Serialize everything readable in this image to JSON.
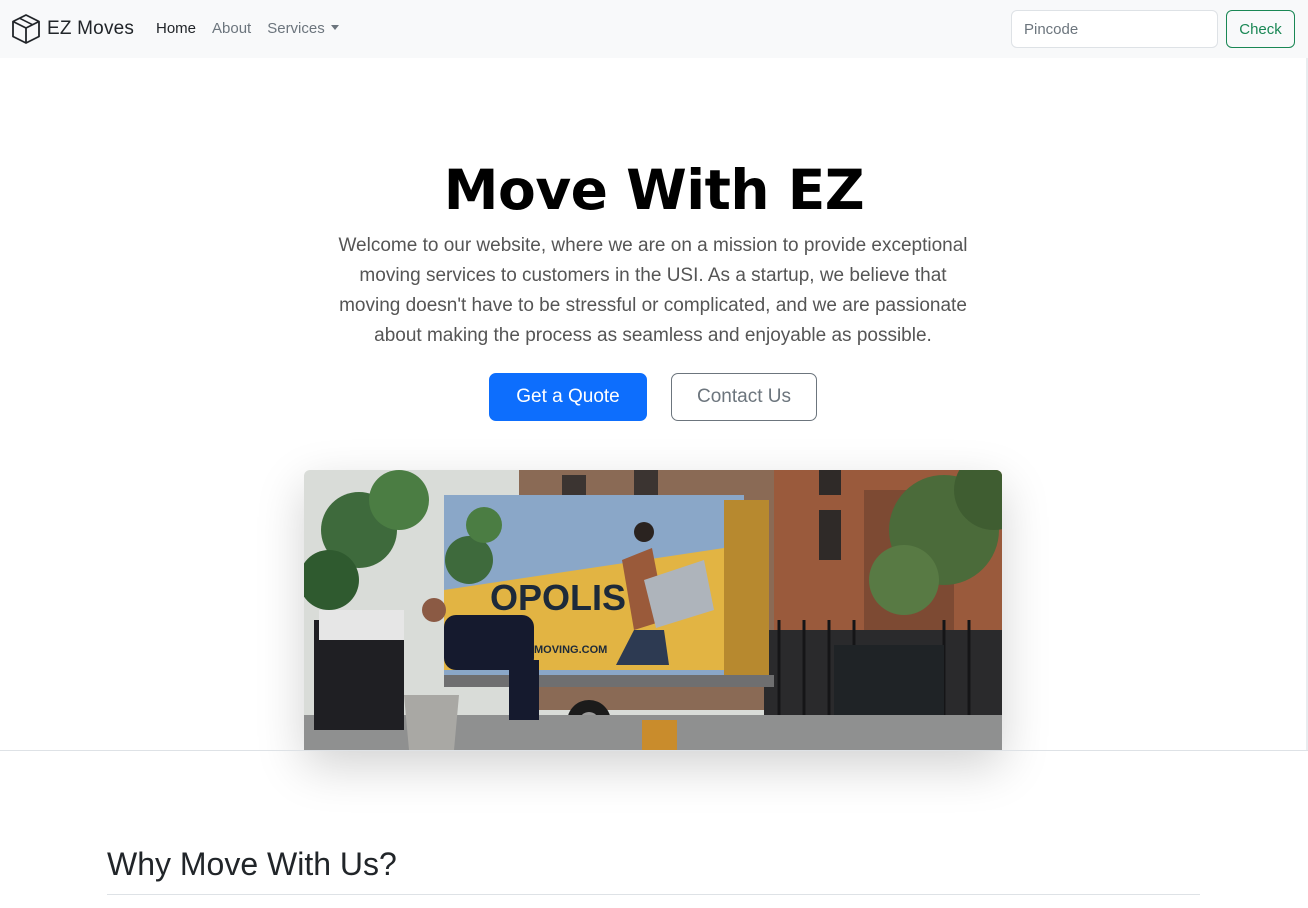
{
  "navbar": {
    "brand": "EZ Moves",
    "links": [
      {
        "label": "Home"
      },
      {
        "label": "About"
      },
      {
        "label": "Services"
      }
    ],
    "search_placeholder": "Pincode",
    "check_label": "Check"
  },
  "hero": {
    "title": "Move With EZ",
    "lead": "Welcome to our website, where we are on a mission to provide exceptional moving services to customers in the USI. As a startup, we believe that moving doesn't have to be stressful or complicated, and we are passionate about making the process as seamless and enjoyable as possible.",
    "primary_label": "Get a Quote",
    "secondary_label": "Contact Us",
    "truck_text": "OPOLIS",
    "truck_subtext": "MOVING.COM"
  },
  "section": {
    "title": "Why Move With Us?"
  },
  "colors": {
    "primary": "#0d6efd",
    "success": "#198754",
    "secondary": "#6c757d",
    "navbar_bg": "#f8f9fa"
  },
  "icons": {
    "brand": "box-icon",
    "services": "caret-down-icon"
  }
}
